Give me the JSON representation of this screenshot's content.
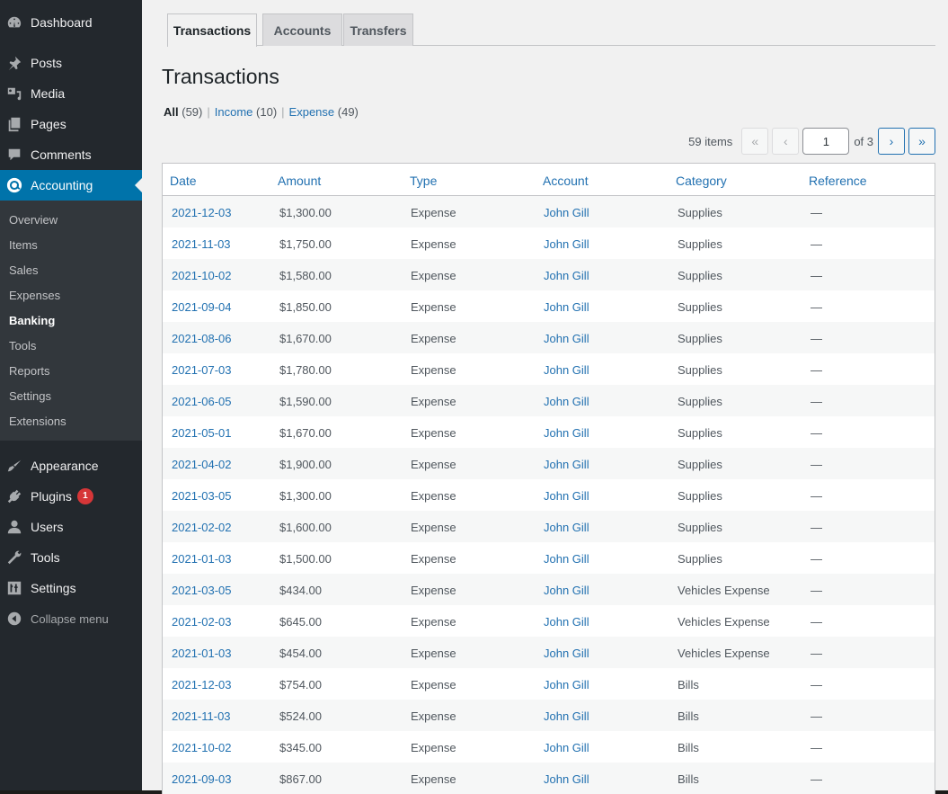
{
  "sidebar": {
    "top_items": [
      {
        "label": "Dashboard",
        "icon": "dashboard-icon"
      },
      {
        "label": "Posts",
        "icon": "pin-icon"
      },
      {
        "label": "Media",
        "icon": "media-icon"
      },
      {
        "label": "Pages",
        "icon": "pages-icon"
      },
      {
        "label": "Comments",
        "icon": "comment-icon"
      },
      {
        "label": "Accounting",
        "icon": "accounting-icon",
        "current": true
      }
    ],
    "submenu": [
      {
        "label": "Overview"
      },
      {
        "label": "Items"
      },
      {
        "label": "Sales"
      },
      {
        "label": "Expenses"
      },
      {
        "label": "Banking",
        "active": true
      },
      {
        "label": "Tools"
      },
      {
        "label": "Reports"
      },
      {
        "label": "Settings"
      },
      {
        "label": "Extensions"
      }
    ],
    "bottom_items": [
      {
        "label": "Appearance",
        "icon": "paintbrush-icon"
      },
      {
        "label": "Plugins",
        "icon": "plugin-icon",
        "badge": "1"
      },
      {
        "label": "Users",
        "icon": "user-icon"
      },
      {
        "label": "Tools",
        "icon": "wrench-icon"
      },
      {
        "label": "Settings",
        "icon": "settings-icon"
      }
    ],
    "collapse_label": "Collapse menu"
  },
  "tabs": [
    {
      "label": "Transactions",
      "active": true
    },
    {
      "label": "Accounts"
    },
    {
      "label": "Transfers"
    }
  ],
  "page_title": "Transactions",
  "filters": {
    "all": {
      "label": "All",
      "count": "(59)"
    },
    "income": {
      "label": "Income",
      "count": "(10)"
    },
    "expense": {
      "label": "Expense",
      "count": "(49)"
    },
    "separator": "|"
  },
  "pagination": {
    "items_text": "59 items",
    "first": "«",
    "prev": "‹",
    "current_page": "1",
    "of_text": "of 3",
    "next": "›",
    "last": "»"
  },
  "table": {
    "columns": [
      "Date",
      "Amount",
      "Type",
      "Account",
      "Category",
      "Reference"
    ],
    "rows": [
      {
        "date": "2021-12-03",
        "amount": "$1,300.00",
        "type": "Expense",
        "account": "John Gill",
        "category": "Supplies",
        "reference": "—"
      },
      {
        "date": "2021-11-03",
        "amount": "$1,750.00",
        "type": "Expense",
        "account": "John Gill",
        "category": "Supplies",
        "reference": "—"
      },
      {
        "date": "2021-10-02",
        "amount": "$1,580.00",
        "type": "Expense",
        "account": "John Gill",
        "category": "Supplies",
        "reference": "—"
      },
      {
        "date": "2021-09-04",
        "amount": "$1,850.00",
        "type": "Expense",
        "account": "John Gill",
        "category": "Supplies",
        "reference": "—"
      },
      {
        "date": "2021-08-06",
        "amount": "$1,670.00",
        "type": "Expense",
        "account": "John Gill",
        "category": "Supplies",
        "reference": "—"
      },
      {
        "date": "2021-07-03",
        "amount": "$1,780.00",
        "type": "Expense",
        "account": "John Gill",
        "category": "Supplies",
        "reference": "—"
      },
      {
        "date": "2021-06-05",
        "amount": "$1,590.00",
        "type": "Expense",
        "account": "John Gill",
        "category": "Supplies",
        "reference": "—"
      },
      {
        "date": "2021-05-01",
        "amount": "$1,670.00",
        "type": "Expense",
        "account": "John Gill",
        "category": "Supplies",
        "reference": "—"
      },
      {
        "date": "2021-04-02",
        "amount": "$1,900.00",
        "type": "Expense",
        "account": "John Gill",
        "category": "Supplies",
        "reference": "—"
      },
      {
        "date": "2021-03-05",
        "amount": "$1,300.00",
        "type": "Expense",
        "account": "John Gill",
        "category": "Supplies",
        "reference": "—"
      },
      {
        "date": "2021-02-02",
        "amount": "$1,600.00",
        "type": "Expense",
        "account": "John Gill",
        "category": "Supplies",
        "reference": "—"
      },
      {
        "date": "2021-01-03",
        "amount": "$1,500.00",
        "type": "Expense",
        "account": "John Gill",
        "category": "Supplies",
        "reference": "—"
      },
      {
        "date": "2021-03-05",
        "amount": "$434.00",
        "type": "Expense",
        "account": "John Gill",
        "category": "Vehicles Expense",
        "reference": "—"
      },
      {
        "date": "2021-02-03",
        "amount": "$645.00",
        "type": "Expense",
        "account": "John Gill",
        "category": "Vehicles Expense",
        "reference": "—"
      },
      {
        "date": "2021-01-03",
        "amount": "$454.00",
        "type": "Expense",
        "account": "John Gill",
        "category": "Vehicles Expense",
        "reference": "—"
      },
      {
        "date": "2021-12-03",
        "amount": "$754.00",
        "type": "Expense",
        "account": "John Gill",
        "category": "Bills",
        "reference": "—"
      },
      {
        "date": "2021-11-03",
        "amount": "$524.00",
        "type": "Expense",
        "account": "John Gill",
        "category": "Bills",
        "reference": "—"
      },
      {
        "date": "2021-10-02",
        "amount": "$345.00",
        "type": "Expense",
        "account": "John Gill",
        "category": "Bills",
        "reference": "—"
      },
      {
        "date": "2021-09-03",
        "amount": "$867.00",
        "type": "Expense",
        "account": "John Gill",
        "category": "Bills",
        "reference": "—"
      }
    ]
  },
  "colors": {
    "sidebar_bg": "#23282d",
    "submenu_bg": "#32373c",
    "accent": "#0073aa",
    "link": "#2271b1",
    "badge": "#d63638"
  }
}
